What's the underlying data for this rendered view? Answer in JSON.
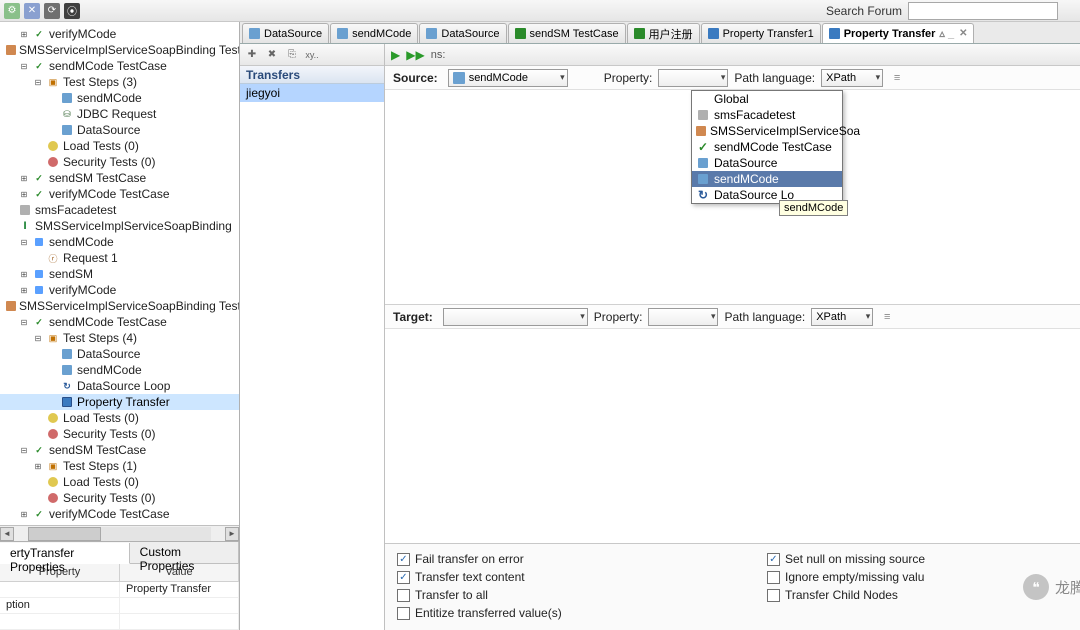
{
  "top": {
    "search_label": "Search Forum",
    "search_value": ""
  },
  "tree": [
    {
      "lvl": 1,
      "tw": "⊞",
      "ic": "case",
      "label": "verifyMCode"
    },
    {
      "lvl": 0,
      "tw": "",
      "ic": "suite",
      "label": "SMSServiceImplServiceSoapBinding TestSuit"
    },
    {
      "lvl": 1,
      "tw": "⊟",
      "ic": "case",
      "label": "sendMCode TestCase"
    },
    {
      "lvl": 2,
      "tw": "⊟",
      "ic": "steps",
      "label": "Test Steps (3)"
    },
    {
      "lvl": 3,
      "tw": "",
      "ic": "step",
      "label": "sendMCode"
    },
    {
      "lvl": 3,
      "tw": "",
      "ic": "db",
      "label": "JDBC Request"
    },
    {
      "lvl": 3,
      "tw": "",
      "ic": "step",
      "label": "DataSource"
    },
    {
      "lvl": 2,
      "tw": "",
      "ic": "load",
      "label": "Load Tests (0)"
    },
    {
      "lvl": 2,
      "tw": "",
      "ic": "sec",
      "label": "Security Tests (0)"
    },
    {
      "lvl": 1,
      "tw": "⊞",
      "ic": "case",
      "label": "sendSM TestCase"
    },
    {
      "lvl": 1,
      "tw": "⊞",
      "ic": "case",
      "label": "verifyMCode TestCase"
    },
    {
      "lvl": 0,
      "tw": "",
      "ic": "folder",
      "label": "smsFacadetest"
    },
    {
      "lvl": 0,
      "tw": "",
      "ic": "iface",
      "label": "SMSServiceImplServiceSoapBinding"
    },
    {
      "lvl": 1,
      "tw": "⊟",
      "ic": "op",
      "label": "sendMCode"
    },
    {
      "lvl": 2,
      "tw": "",
      "ic": "req",
      "label": "Request 1"
    },
    {
      "lvl": 1,
      "tw": "⊞",
      "ic": "op",
      "label": "sendSM"
    },
    {
      "lvl": 1,
      "tw": "⊞",
      "ic": "op",
      "label": "verifyMCode"
    },
    {
      "lvl": 0,
      "tw": "",
      "ic": "suite",
      "label": "SMSServiceImplServiceSoapBinding TestSuit"
    },
    {
      "lvl": 1,
      "tw": "⊟",
      "ic": "case",
      "label": "sendMCode TestCase"
    },
    {
      "lvl": 2,
      "tw": "⊟",
      "ic": "steps",
      "label": "Test Steps (4)"
    },
    {
      "lvl": 3,
      "tw": "",
      "ic": "step",
      "label": "DataSource"
    },
    {
      "lvl": 3,
      "tw": "",
      "ic": "step",
      "label": "sendMCode"
    },
    {
      "lvl": 3,
      "tw": "",
      "ic": "loop",
      "label": "DataSource Loop"
    },
    {
      "lvl": 3,
      "tw": "",
      "ic": "pt",
      "label": "Property Transfer",
      "sel": true
    },
    {
      "lvl": 2,
      "tw": "",
      "ic": "load",
      "label": "Load Tests (0)"
    },
    {
      "lvl": 2,
      "tw": "",
      "ic": "sec",
      "label": "Security Tests (0)"
    },
    {
      "lvl": 1,
      "tw": "⊟",
      "ic": "case",
      "label": "sendSM TestCase"
    },
    {
      "lvl": 2,
      "tw": "⊞",
      "ic": "steps",
      "label": "Test Steps (1)"
    },
    {
      "lvl": 2,
      "tw": "",
      "ic": "load",
      "label": "Load Tests (0)"
    },
    {
      "lvl": 2,
      "tw": "",
      "ic": "sec",
      "label": "Security Tests (0)"
    },
    {
      "lvl": 1,
      "tw": "⊞",
      "ic": "case",
      "label": "verifyMCode TestCase"
    }
  ],
  "prop_tabs": {
    "t1": "ertyTransfer Properties",
    "t2": "Custom Properties"
  },
  "prop_grid": {
    "h1": "Property",
    "h2": "Value",
    "r1c1": "",
    "r1c2": "Property Transfer",
    "r2c1": "ption",
    "r2c2": ""
  },
  "tabs": [
    {
      "label": "DataSource",
      "color": "#6aa0d0"
    },
    {
      "label": "sendMCode",
      "color": "#6aa0d0"
    },
    {
      "label": "DataSource",
      "color": "#6aa0d0"
    },
    {
      "label": "sendSM TestCase",
      "color": "#2a8a2a"
    },
    {
      "label": "用户注册",
      "color": "#2a8a2a"
    },
    {
      "label": "Property Transfer1",
      "color": "#3a7ac0"
    },
    {
      "label": "Property Transfer",
      "color": "#3a7ac0",
      "active": true
    }
  ],
  "transfers": {
    "header": "Transfers",
    "items": [
      "jiegyoi"
    ]
  },
  "toolbar": {
    "ns": "ns:"
  },
  "source": {
    "label": "Source:",
    "combo": "sendMCode",
    "prop_label": "Property:",
    "prop": "",
    "lang_label": "Path language:",
    "lang": "XPath"
  },
  "target": {
    "label": "Target:",
    "combo": "",
    "prop_label": "Property:",
    "prop": "",
    "lang_label": "Path language:",
    "lang": "XPath"
  },
  "dropdown": {
    "items": [
      {
        "label": "Global",
        "ic": ""
      },
      {
        "label": "smsFacadetest",
        "ic": "folder"
      },
      {
        "label": "SMSServiceImplServiceSoa",
        "ic": "suite"
      },
      {
        "label": "sendMCode TestCase",
        "ic": "case"
      },
      {
        "label": "DataSource",
        "ic": "step"
      },
      {
        "label": "sendMCode",
        "ic": "step",
        "hl": true
      },
      {
        "label": "DataSource Lo",
        "ic": "loop"
      }
    ],
    "tooltip": "sendMCode"
  },
  "options": {
    "left": [
      {
        "label": "Fail transfer on error",
        "checked": true
      },
      {
        "label": "Transfer text content",
        "checked": true
      },
      {
        "label": "Transfer to all",
        "checked": false
      },
      {
        "label": "Entitize transferred value(s)",
        "checked": false
      }
    ],
    "right": [
      {
        "label": "Set null on missing source",
        "checked": true
      },
      {
        "label": "Ignore empty/missing valu",
        "checked": false
      },
      {
        "label": "Transfer Child Nodes",
        "checked": false
      }
    ]
  },
  "watermark": "龙腾测试"
}
